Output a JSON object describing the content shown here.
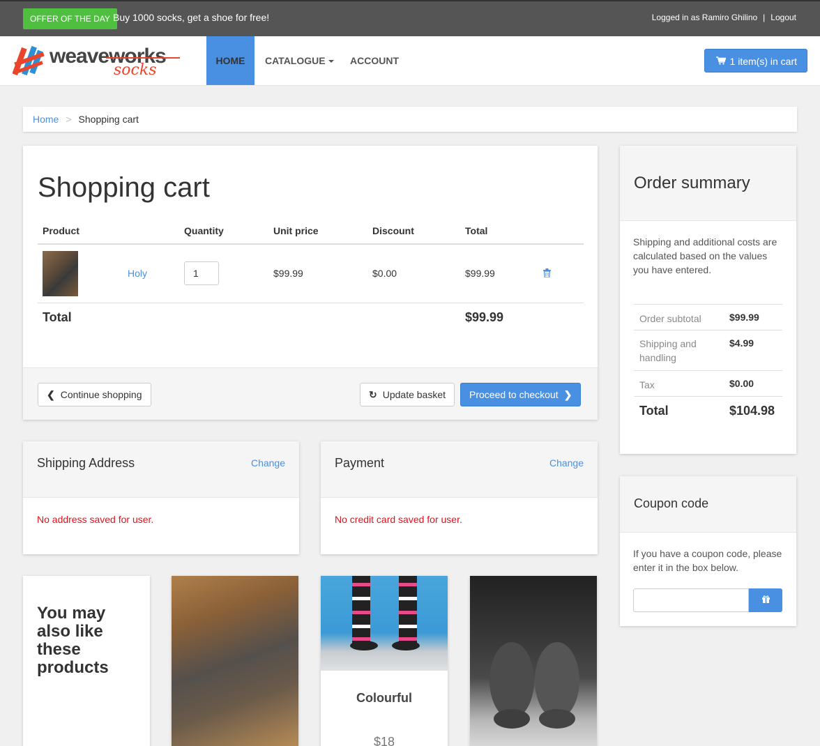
{
  "topbar": {
    "offer_badge": "OFFER OF THE DAY",
    "offer_text": "Buy 1000 socks, get a shoe for free!",
    "logged_in": "Logged in as Ramiro Ghilino",
    "separator": "|",
    "logout": "Logout"
  },
  "brand": {
    "word1": "weave",
    "word2": "works",
    "word3": "socks"
  },
  "nav": {
    "home": "HOME",
    "catalogue": "CATALOGUE",
    "account": "ACCOUNT",
    "cart_button": "1 item(s) in cart"
  },
  "breadcrumb": {
    "home": "Home",
    "current": "Shopping cart"
  },
  "cart": {
    "title": "Shopping cart",
    "headers": [
      "Product",
      "Quantity",
      "Unit price",
      "Discount",
      "Total"
    ],
    "items": [
      {
        "name": "Holy",
        "quantity": "1",
        "unit_price": "$99.99",
        "discount": "$0.00",
        "total": "$99.99"
      }
    ],
    "total_label": "Total",
    "total_value": "$99.99",
    "continue_label": "Continue shopping",
    "update_label": "Update basket",
    "checkout_label": "Proceed to checkout"
  },
  "summary": {
    "title": "Order summary",
    "note": "Shipping and additional costs are calculated based on the values you have entered.",
    "rows": [
      {
        "label": "Order subtotal",
        "value": "$99.99"
      },
      {
        "label": "Shipping and handling",
        "value": "$4.99"
      },
      {
        "label": "Tax",
        "value": "$0.00"
      },
      {
        "label": "Total",
        "value": "$104.98"
      }
    ]
  },
  "coupon": {
    "title": "Coupon code",
    "note": "If you have a coupon code, please enter it in the box below.",
    "input_value": ""
  },
  "shipping": {
    "title": "Shipping Address",
    "change": "Change",
    "message": "No address saved for user."
  },
  "payment": {
    "title": "Payment",
    "change": "Change",
    "message": "No credit card saved for user."
  },
  "recommend": {
    "title": "You may also like these products",
    "products": [
      {
        "name": "",
        "price": ""
      },
      {
        "name": "Colourful",
        "price": "$18"
      },
      {
        "name": "",
        "price": ""
      }
    ]
  },
  "colors": {
    "accent": "#4a90e2",
    "offer": "#4fbf40",
    "error": "#e3101a",
    "brand_red": "#e8452c"
  }
}
